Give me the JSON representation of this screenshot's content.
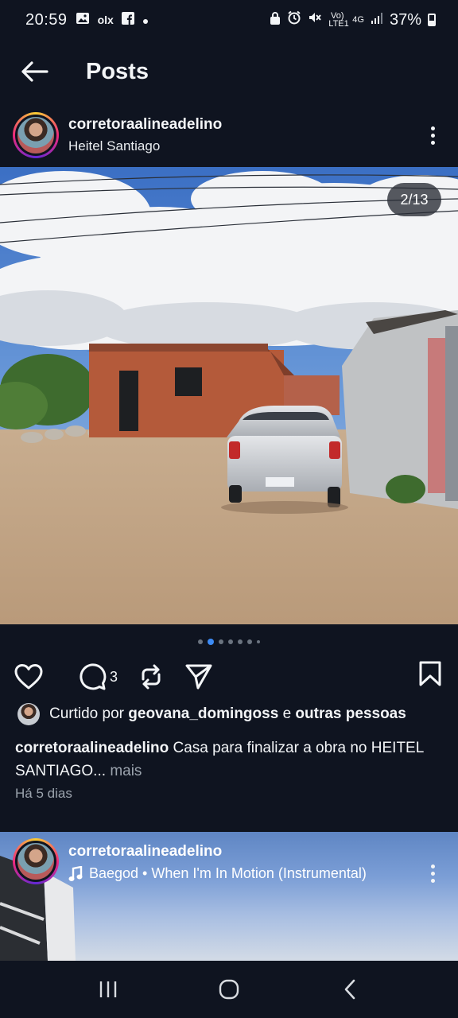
{
  "status_bar": {
    "time": "20:59",
    "left_icons": [
      "gallery-icon",
      "olx-icon",
      "facebook-icon",
      "dot-icon"
    ],
    "olx_text": "olx",
    "volte_text": "Vo) LTE1",
    "network_text": "4G",
    "battery_percent": "37%"
  },
  "header": {
    "title": "Posts"
  },
  "post": {
    "username": "corretoraalineadelino",
    "location": "Heitel Santiago",
    "image_counter": "2/13",
    "carousel": {
      "total_dots": 7,
      "active_index": 1
    },
    "comment_count": "3",
    "likes": {
      "prefix": "Curtido por",
      "user": "geovana_domingoss",
      "joiner": "e",
      "others": "outras pessoas"
    },
    "caption": {
      "username": "corretoraalineadelino",
      "text": "Casa para finalizar a obra no HEITEL SANTIAGO...",
      "more": "mais"
    },
    "time_ago": "Há 5 dias"
  },
  "next_post": {
    "username": "corretoraalineadelino",
    "music": "Baegod • When I'm In Motion (Instrumental)"
  },
  "colors": {
    "background": "#0f1420",
    "accent_dot": "#3d8bf5",
    "muted_text": "#9ba3ad"
  }
}
